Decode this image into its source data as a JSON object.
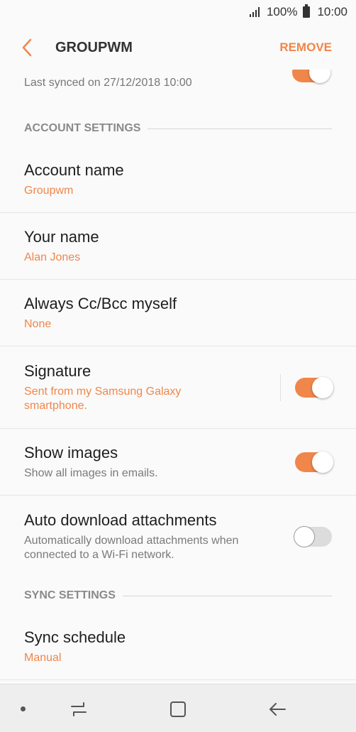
{
  "status_bar": {
    "battery": "100%",
    "time": "10:00"
  },
  "header": {
    "title": "GROUPWM",
    "action": "REMOVE"
  },
  "sync_row": {
    "subtitle": "Last synced on 27/12/2018  10:00",
    "toggle_on": true
  },
  "sections": {
    "account": "ACCOUNT SETTINGS",
    "sync": "SYNC SETTINGS"
  },
  "account_name": {
    "title": "Account name",
    "value": "Groupwm"
  },
  "your_name": {
    "title": "Your name",
    "value": "Alan Jones"
  },
  "cc_bcc": {
    "title": "Always Cc/Bcc myself",
    "value": "None"
  },
  "signature": {
    "title": "Signature",
    "line1": "Sent from my Samsung Galaxy",
    "line2": "smartphone.",
    "toggle_on": true
  },
  "show_images": {
    "title": "Show images",
    "subtitle": "Show all images in emails.",
    "toggle_on": true
  },
  "auto_download": {
    "title": "Auto download attachments",
    "line1": "Automatically download attachments when",
    "line2": "connected to a Wi-Fi network.",
    "toggle_on": false
  },
  "sync_schedule": {
    "title": "Sync schedule",
    "value": "Manual"
  },
  "colors": {
    "accent": "#f0864a",
    "background": "#fafafa"
  }
}
